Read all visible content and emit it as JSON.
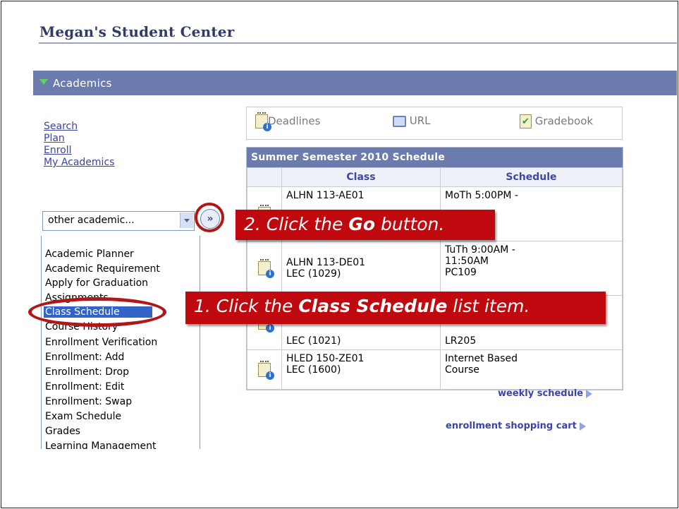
{
  "title": "Megan's Student Center",
  "section": {
    "label": "Academics"
  },
  "nav_links": [
    "Search",
    "Plan",
    "Enroll",
    "My Academics"
  ],
  "dropdown": {
    "value": "other academic..."
  },
  "go_button": {
    "glyph": "»"
  },
  "list_items": [
    "Academic Planner",
    "Academic Requirement",
    "Apply for Graduation",
    "Assignments",
    "Class Schedule",
    "Course History",
    "Enrollment Verification",
    "Enrollment: Add",
    "Enrollment: Drop",
    "Enrollment: Edit",
    "Enrollment: Swap",
    "Exam Schedule",
    "Grades",
    "Learning Management"
  ],
  "selected_item": "Class Schedule",
  "toolbar": {
    "deadlines": "Deadlines",
    "url": "URL",
    "gradebook": "Gradebook"
  },
  "schedule": {
    "title": "Summer Semester 2010 Schedule",
    "col_class": "Class",
    "col_schedule": "Schedule",
    "rows": [
      {
        "class_line1": "ALHN 113-AE01",
        "class_line2": "",
        "sched_line1": "MoTh 5:00PM -",
        "sched_line2": "",
        "sched_line3": ""
      },
      {
        "class_line1": "ALHN 113-DE01",
        "class_line2": "LEC (1029)",
        "sched_line1": "TuTh 9:00AM -",
        "sched_line2": "11:50AM",
        "sched_line3": "PC109"
      },
      {
        "class_line1": "",
        "class_line2": "LEC (1021)",
        "sched_line1": "",
        "sched_line2": "",
        "sched_line3": "LR205"
      },
      {
        "class_line1": "HLED 150-ZE01",
        "class_line2": "LEC (1600)",
        "sched_line1": "Internet Based",
        "sched_line2": "Course",
        "sched_line3": ""
      }
    ]
  },
  "links_bottom": {
    "weekly": "weekly schedule",
    "cart": "enrollment shopping cart"
  },
  "callouts": {
    "step1_prefix": "1.  Click the ",
    "step1_bold": "Class Schedule",
    "step1_suffix": " list item.",
    "step2_prefix": "2.  Click the ",
    "step2_bold": "Go",
    "step2_suffix": " button."
  },
  "colors": {
    "section_bar": "#6c7bae",
    "callout": "#c0090f",
    "highlight_ring": "#b01818",
    "selection": "#3163c9"
  }
}
